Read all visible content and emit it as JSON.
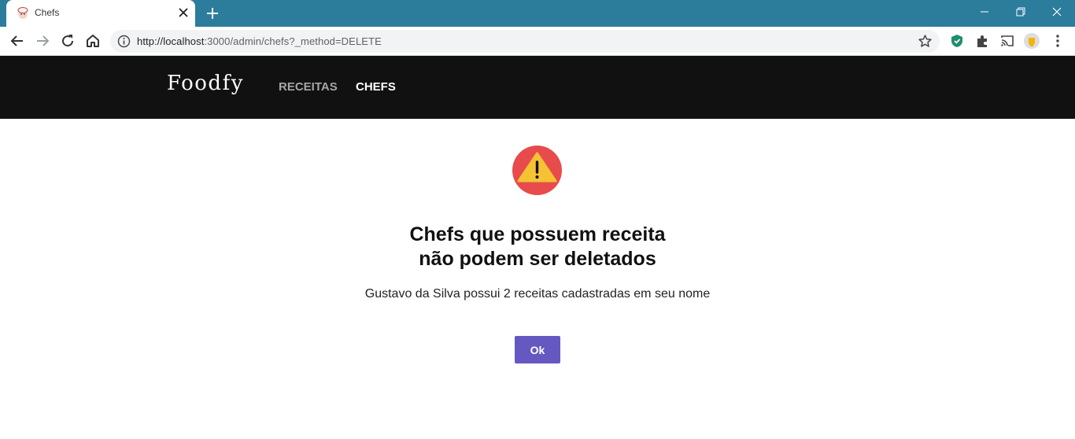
{
  "browser": {
    "tab_title": "Chefs",
    "url_host": "http://localhost",
    "url_rest": ":3000/admin/chefs?_method=DELETE"
  },
  "site": {
    "logo": "Foodfy",
    "nav": [
      {
        "label": "RECEITAS",
        "active": false
      },
      {
        "label": "CHEFS",
        "active": true
      }
    ]
  },
  "alert": {
    "icon": "warning-icon",
    "title_line1": "Chefs que possuem receita",
    "title_line2": "não podem ser deletados",
    "text": "Gustavo da Silva possui 2 receitas cadastradas em seu nome",
    "button_label": "Ok"
  },
  "colors": {
    "titlebar": "#2c7c9c",
    "header": "#111111",
    "button": "#6558c0",
    "warning_circle": "#e84b4b",
    "warning_triangle": "#f4c233"
  }
}
